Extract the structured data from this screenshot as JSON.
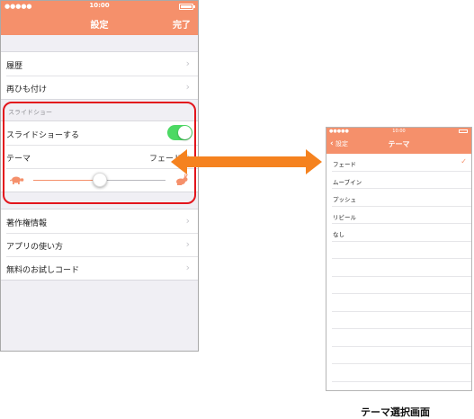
{
  "settings": {
    "status": {
      "time": "10:00",
      "signal": "●●●●●"
    },
    "nav": {
      "title": "設定",
      "done": "完了"
    },
    "group1": [
      "履歴",
      "再ひも付け"
    ],
    "slideshow": {
      "section_title": "スライドショー",
      "toggle_label": "スライドショーする",
      "toggle_on": true,
      "theme_label": "テーマ",
      "theme_value": "フェード",
      "speed_fraction": 0.5
    },
    "group2": [
      "著作権情報",
      "アプリの使い方",
      "無料のお試しコード"
    ]
  },
  "theme_screen": {
    "status": {
      "time": "10:00",
      "signal": "●●●●●"
    },
    "nav": {
      "back": "設定",
      "title": "テーマ"
    },
    "items": [
      "フェード",
      "ムーブイン",
      "プッシュ",
      "リビール",
      "なし"
    ],
    "selected_index": 0,
    "empty_rows": 9,
    "check": "✓"
  },
  "caption": "テーマ選択画面",
  "colors": {
    "accent": "#f5906b",
    "toggle": "#4cd964",
    "highlight": "#e3151c",
    "arrow": "#f5821f"
  }
}
